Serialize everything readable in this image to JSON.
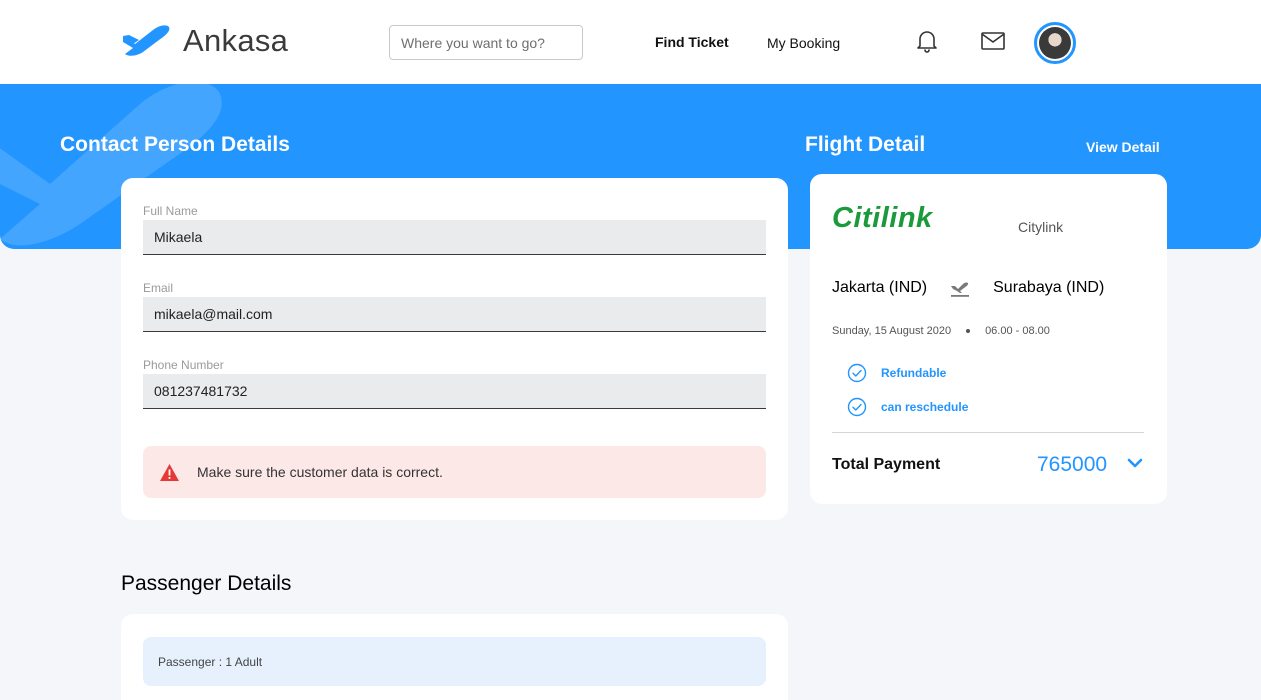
{
  "header": {
    "brand": "Ankasa",
    "search_placeholder": "Where you want to go?",
    "nav_find_ticket": "Find Ticket",
    "nav_my_booking": "My Booking"
  },
  "contact": {
    "title": "Contact Person Details",
    "full_name_label": "Full Name",
    "full_name_value": "Mikaela",
    "email_label": "Email",
    "email_value": "mikaela@mail.com",
    "phone_label": "Phone Number",
    "phone_value": "081237481732",
    "alert_text": "Make sure the customer data is correct."
  },
  "flight": {
    "title": "Flight Detail",
    "view_detail": "View Detail",
    "airline_logo_text": "Citilink",
    "airline_name": "Citylink",
    "origin": "Jakarta (IND)",
    "destination": "Surabaya (IND)",
    "date": "Sunday, 15 August 2020",
    "time": "06.00 - 08.00",
    "features": [
      "Refundable",
      "can reschedule"
    ],
    "total_label": "Total Payment",
    "total_value": "765000"
  },
  "passenger": {
    "title": "Passenger Details",
    "summary": "Passenger : 1 Adult"
  },
  "colors": {
    "primary": "#2395ff",
    "alert_bg": "#fde8e8",
    "alert_icon": "#e53935"
  }
}
